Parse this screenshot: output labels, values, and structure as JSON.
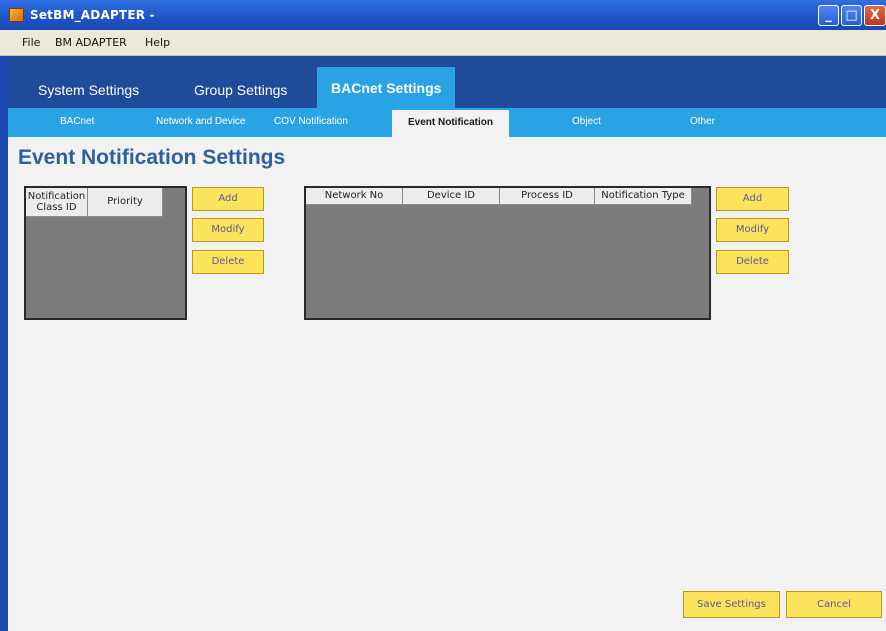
{
  "window": {
    "title": "SetBM_ADAPTER -",
    "minimize_glyph": "_",
    "maximize_glyph": "□",
    "close_glyph": "X"
  },
  "menu": {
    "items": [
      {
        "label": "File"
      },
      {
        "label": "BM ADAPTER"
      },
      {
        "label": "Help"
      }
    ]
  },
  "main_tabs": [
    {
      "label": "System Settings"
    },
    {
      "label": "Group Settings"
    },
    {
      "label": "BACnet Settings",
      "active": true
    }
  ],
  "sub_tabs": [
    {
      "label": "BACnet"
    },
    {
      "label": "Network and Device"
    },
    {
      "label": "COV Notification"
    },
    {
      "label": "Event Notification",
      "active": true
    },
    {
      "label": "Object"
    },
    {
      "label": "Other"
    }
  ],
  "page_title": "Event Notification Settings",
  "left_grid": {
    "columns": [
      {
        "line1": "Notification",
        "line2": "Class ID"
      },
      {
        "line1": "Priority"
      }
    ],
    "rows": []
  },
  "right_grid": {
    "columns": [
      {
        "label": "Network No"
      },
      {
        "label": "Device ID"
      },
      {
        "label": "Process ID"
      },
      {
        "label": "Notification Type"
      }
    ],
    "rows": []
  },
  "left_buttons": {
    "add": "Add",
    "modify": "Modify",
    "delete": "Delete"
  },
  "right_buttons": {
    "add": "Add",
    "modify": "Modify",
    "delete": "Delete"
  },
  "footer": {
    "save": "Save Settings",
    "cancel": "Cancel"
  },
  "colors": {
    "titlebar": "#2f6fe0",
    "main_tab_bar": "#1e4c9a",
    "active_tab": "#2aa3e4",
    "page_title": "#2e5f9e",
    "button_yellow": "#fbe35c",
    "grid_body": "#7c7c7c"
  }
}
